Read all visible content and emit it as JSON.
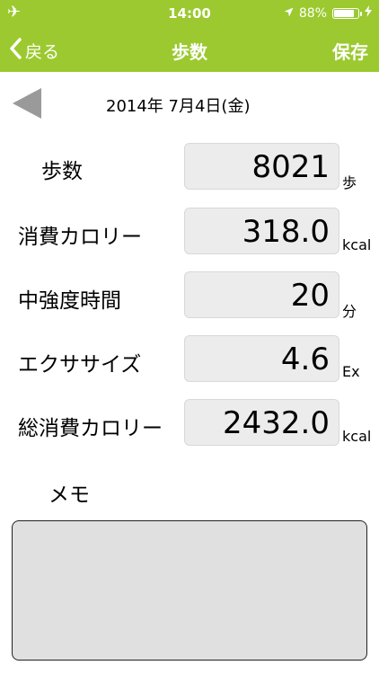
{
  "status_bar": {
    "time": "14:00",
    "battery_percent": "88%",
    "battery_level": 0.88
  },
  "nav": {
    "back_label": "戻る",
    "title": "歩数",
    "save_label": "保存"
  },
  "date": "2014年 7月4日(金)",
  "rows": [
    {
      "label": "歩数",
      "value": "8021",
      "unit": "歩"
    },
    {
      "label": "消費カロリー",
      "value": "318.0",
      "unit": "kcal"
    },
    {
      "label": "中強度時間",
      "value": "20",
      "unit": "分"
    },
    {
      "label": "エクササイズ",
      "value": "4.6",
      "unit": "Ex"
    },
    {
      "label": "総消費カロリー",
      "value": "2432.0",
      "unit": "kcal"
    }
  ],
  "memo": {
    "label": "メモ",
    "value": ""
  },
  "colors": {
    "accent": "#9bc92f",
    "field_bg": "#ececec",
    "memo_bg": "#e0e0e0"
  }
}
